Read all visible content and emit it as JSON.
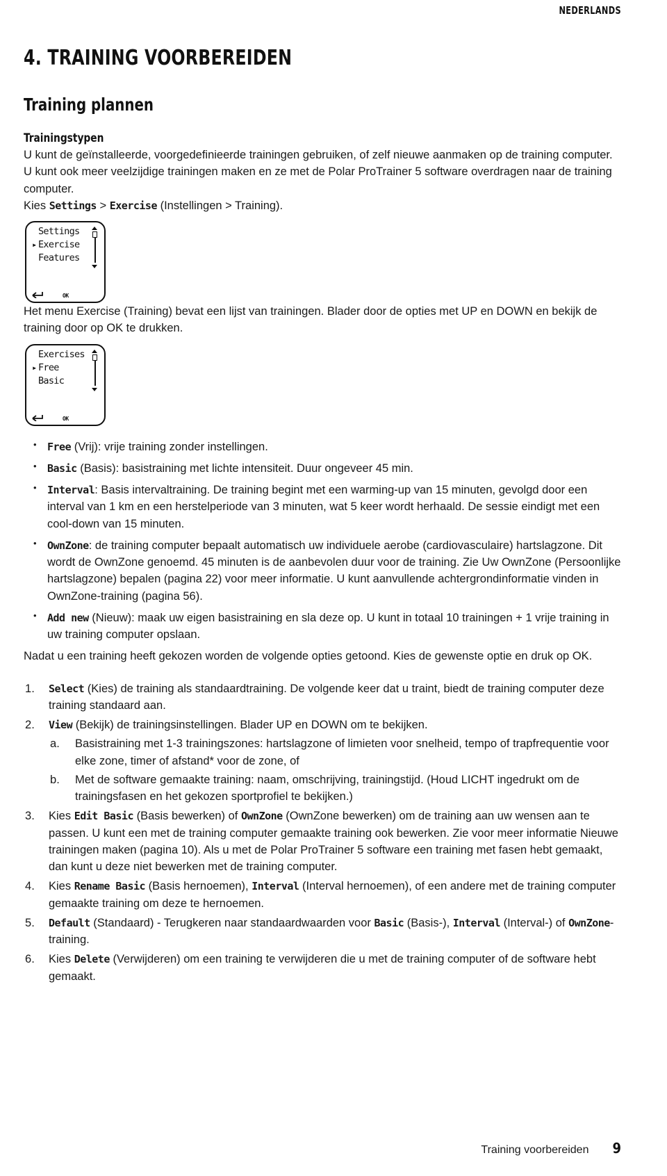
{
  "running_head": "NEDERLANDS",
  "chapter_title": "4. TRAINING VOORBEREIDEN",
  "section_title": "Training plannen",
  "subsection_title": "Trainingstypen",
  "intro_paragraph": "U kunt de geïnstalleerde, voorgedefinieerde trainingen gebruiken, of zelf nieuwe aanmaken op de training computer. U kunt ook meer veelzijdige trainingen maken en ze met de Polar ProTrainer 5 software overdragen naar de training computer.",
  "path_line": {
    "prefix": "Kies ",
    "item1": "Settings",
    "separator": " > ",
    "item2": "Exercise",
    "suffix": " (Instellingen > Training)."
  },
  "device_screens": [
    {
      "name": "settings-menu",
      "rows": [
        {
          "label": "Settings",
          "selected": false
        },
        {
          "label": "Exercise",
          "selected": true
        },
        {
          "label": "Features",
          "selected": false
        }
      ],
      "ok_label": "OK",
      "back_icon": "back-arrow-icon",
      "scrollbar": "vertical-scrollbar"
    },
    {
      "name": "exercises-menu",
      "rows": [
        {
          "label": "Exercises",
          "selected": false
        },
        {
          "label": "Free",
          "selected": true
        },
        {
          "label": "Basic",
          "selected": false
        }
      ],
      "ok_label": "OK",
      "back_icon": "back-arrow-icon",
      "scrollbar": "vertical-scrollbar"
    }
  ],
  "after_first_screen_paragraph": "Het menu Exercise (Training) bevat een lijst van trainingen. Blader door de opties met UP en DOWN en bekijk de training door op OK te drukken.",
  "bullets": [
    {
      "term": "Free",
      "rest": " (Vrij): vrije training zonder instellingen."
    },
    {
      "term": "Basic",
      "rest": " (Basis): basistraining met lichte intensiteit. Duur ongeveer 45 min."
    },
    {
      "term": "Interval",
      "rest": ": Basis intervaltraining. De training begint met een warming-up van 15 minuten, gevolgd door een interval van 1 km en een herstelperiode van 3 minuten, wat 5 keer wordt herhaald. De sessie eindigt met een cool-down van 15 minuten."
    },
    {
      "term": "OwnZone",
      "rest": ": de training computer bepaalt automatisch uw individuele aerobe (cardiovasculaire) hartslagzone. Dit wordt de OwnZone genoemd. 45 minuten is de aanbevolen duur voor de training. Zie Uw OwnZone (Persoonlijke hartslagzone) bepalen (pagina 22) voor meer informatie. U kunt aanvullende achtergrondinformatie vinden in OwnZone-training (pagina 56)."
    },
    {
      "term": "Add new",
      "rest": " (Nieuw): maak uw eigen basistraining en sla deze op. U kunt in totaal 10 trainingen + 1 vrije training in uw training computer opslaan."
    }
  ],
  "after_bullets_paragraph": "Nadat u een training heeft gekozen worden de volgende opties getoond. Kies de gewenste optie en druk op OK.",
  "numbered": {
    "item1": {
      "term": "Select",
      "rest": " (Kies) de training als standaardtraining. De volgende keer dat u traint, biedt de training computer deze training standaard aan."
    },
    "item2": {
      "term": "View",
      "rest": " (Bekijk) de trainingsinstellingen. Blader UP en DOWN om te bekijken.",
      "sub": [
        "Basistraining met 1-3 trainingszones: hartslagzone of limieten voor snelheid, tempo of trapfrequentie voor elke zone, timer of afstand* voor de zone, of",
        "Met de software gemaakte training: naam, omschrijving, trainingstijd. (Houd LICHT ingedrukt om de trainingsfasen en het gekozen sportprofiel te bekijken.)"
      ]
    },
    "item3": {
      "p1": "Kies ",
      "term1": "Edit Basic",
      "p2": " (Basis bewerken) of ",
      "term2": "OwnZone",
      "p3": " (OwnZone bewerken) om de training aan uw wensen aan te passen. U kunt een met de training computer gemaakte training ook bewerken. Zie voor meer informatie Nieuwe trainingen maken (pagina 10). Als u met de Polar ProTrainer 5 software een training met fasen hebt gemaakt, dan kunt u deze niet bewerken met de training computer."
    },
    "item4": {
      "p1": "Kies ",
      "term1": "Rename Basic",
      "p2": " (Basis hernoemen), ",
      "term2": "Interval",
      "p3": " (Interval hernoemen), of een andere met de training computer gemaakte training om deze te hernoemen."
    },
    "item5": {
      "term1": "Default",
      "p1": " (Standaard) - Terugkeren naar standaardwaarden voor ",
      "term2": "Basic",
      "p2": " (Basis-), ",
      "term3": "Interval",
      "p3": " (Interval-) of ",
      "term4": "OwnZone",
      "p4": "-training."
    },
    "item6": {
      "p1": "Kies ",
      "term1": "Delete",
      "p2": " (Verwijderen) om een training te verwijderen die u met de training computer of de software hebt gemaakt."
    }
  },
  "footer": {
    "name": "Training voorbereiden",
    "page": "9"
  },
  "colors": {
    "text": "#1a1a1a",
    "heading": "#111111",
    "background": "#ffffff"
  }
}
